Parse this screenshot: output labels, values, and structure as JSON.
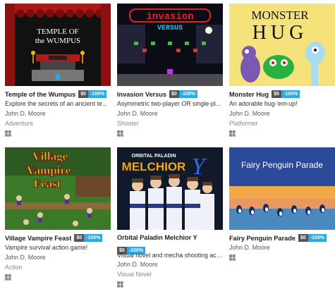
{
  "games": [
    {
      "title": "Temple of the Wumpus",
      "price": "$0",
      "discount": "-100%",
      "description": "Explore the secrets of an ancient te...",
      "author": "John D. Moore",
      "genre": "Adventure",
      "cover_text": [
        "TEMPLE OF",
        "the WUMPUS"
      ]
    },
    {
      "title": "Invasion Versus",
      "price": "$0",
      "discount": "-100%",
      "description": "Asymmetric two-player OR single-pl...",
      "author": "John D. Moore",
      "genre": "Shooter",
      "cover_text": [
        "invasion",
        "VERSUS"
      ]
    },
    {
      "title": "Monster Hug",
      "price": "$0",
      "discount": "-100%",
      "description": "An adorable hug-'em-up!",
      "author": "John D. Moore",
      "genre": "Platformer",
      "cover_text": [
        "MONSTER",
        "HUG"
      ]
    },
    {
      "title": "Village Vampire Feast",
      "price": "$0",
      "discount": "-100%",
      "description": "Vampire survival action game!",
      "author": "John D. Moore",
      "genre": "Action",
      "cover_text": [
        "Village",
        "Vampire",
        "Feast"
      ]
    },
    {
      "title": "Orbital Paladin Melchior Y",
      "price": "$0",
      "discount": "-100%",
      "description": "Visual novel and mecha shooting act...",
      "author": "John D. Moore",
      "genre": "Visual Novel",
      "cover_text": [
        "ORBITAL PALADIN",
        "MELCHIOR",
        "Y"
      ]
    },
    {
      "title": "Fairy Penguin Parade",
      "price": "$0",
      "discount": "-100%",
      "description": "",
      "author": "John D. Moore",
      "genre": "",
      "cover_text": [
        "Fairy Penguin Parade"
      ]
    }
  ],
  "platform_icon": "windows-icon",
  "colors": {
    "discount": "#2aa9e8",
    "price": "#555555"
  }
}
